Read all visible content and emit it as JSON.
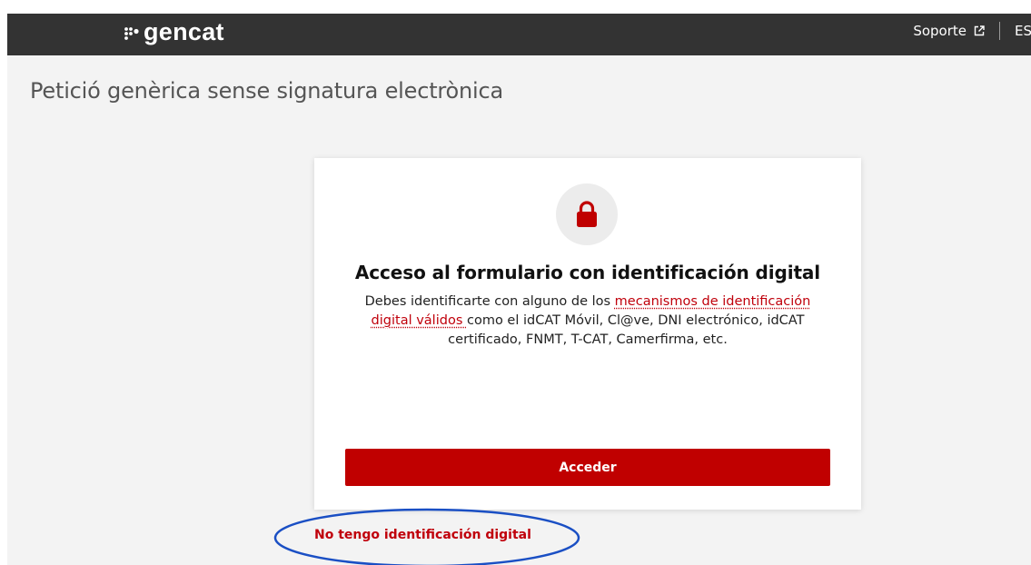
{
  "header": {
    "brand": "gencat",
    "support_label": "Soporte",
    "language_label": "ES"
  },
  "page": {
    "title": "Petició genèrica sense signatura electrònica"
  },
  "card": {
    "heading": "Acceso al formulario con identificación digital",
    "description_before": "Debes identificarte con alguno de los ",
    "description_link": "mecanismos de identificación digital válidos ",
    "description_after": "como el idCAT Móvil, Cl@ve, DNI electrónico, idCAT certificado, FNMT, T-CAT, Camerfirma, etc.",
    "button_label": "Acceder"
  },
  "no_id_link": "No tengo identificación digital",
  "colors": {
    "topbar": "#333333",
    "accent": "#c00000",
    "annotation": "#1a4fc4"
  },
  "icons": {
    "logo": "gencat-dots-icon",
    "support": "external-link-icon",
    "lock": "lock-icon"
  }
}
